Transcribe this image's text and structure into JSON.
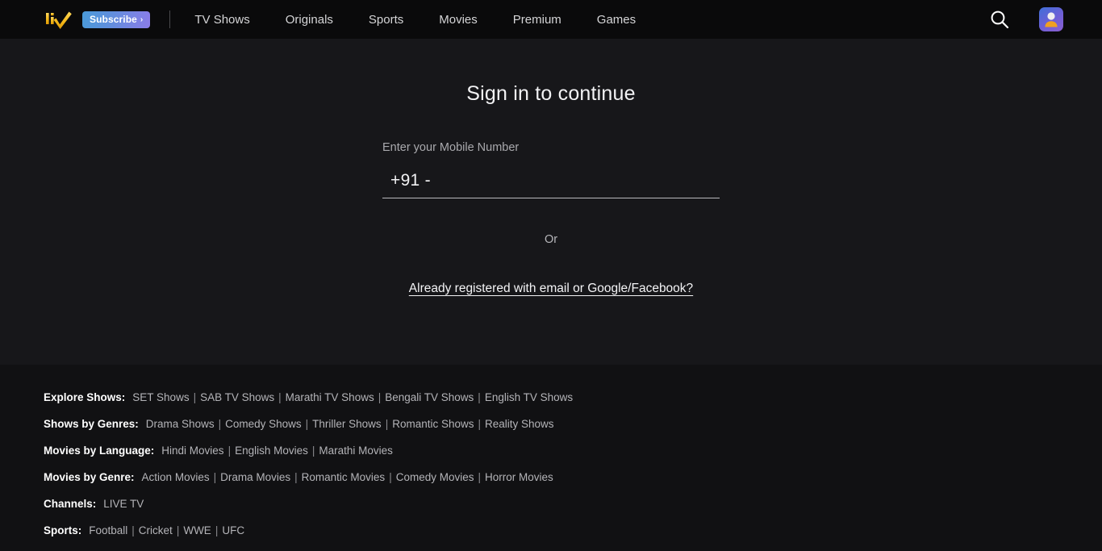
{
  "header": {
    "logo_text": "liv",
    "logo_name": "liv-logo",
    "subscribe_label": "Subscribe",
    "subscribe_chevron": "›",
    "nav_items": [
      {
        "label": "TV Shows"
      },
      {
        "label": "Originals"
      },
      {
        "label": "Sports"
      },
      {
        "label": "Movies"
      },
      {
        "label": "Premium"
      },
      {
        "label": "Games"
      }
    ],
    "search_icon": "search-icon",
    "avatar_icon": "user-avatar-icon",
    "colors": {
      "bar_bg": "#0a0a0b",
      "logo_gold": "#f5c518",
      "subscribe_from": "#4a9ad8",
      "subscribe_to": "#8b7ce8",
      "avatar_from": "#3f6fd8",
      "avatar_to": "#8a5fd0"
    }
  },
  "main": {
    "title": "Sign in to continue",
    "field_label": "Enter your Mobile Number",
    "phone_prefix": "+91 -",
    "phone_placeholder": "",
    "or_text": "Or",
    "already_registered_link": "Already registered with email or Google/Facebook?",
    "colors": {
      "bg": "#17171a",
      "underline": "#b9b9bd"
    }
  },
  "footer": {
    "bg": "#111113",
    "rows": [
      {
        "label": "Explore Shows:",
        "links": [
          "SET Shows",
          "SAB TV Shows",
          "Marathi TV Shows",
          "Bengali TV Shows",
          "English TV Shows"
        ]
      },
      {
        "label": "Shows by Genres:",
        "links": [
          "Drama Shows",
          "Comedy Shows",
          "Thriller Shows",
          "Romantic Shows",
          "Reality Shows"
        ]
      },
      {
        "label": "Movies by Language:",
        "links": [
          "Hindi Movies",
          "English Movies",
          "Marathi Movies"
        ]
      },
      {
        "label": "Movies by Genre:",
        "links": [
          "Action Movies",
          "Drama Movies",
          "Romantic Movies",
          "Comedy Movies",
          "Horror Movies"
        ]
      },
      {
        "label": "Channels:",
        "links": [
          "LIVE TV"
        ]
      },
      {
        "label": "Sports:",
        "links": [
          "Football",
          "Cricket",
          "WWE",
          "UFC"
        ]
      }
    ],
    "separator": "|"
  }
}
